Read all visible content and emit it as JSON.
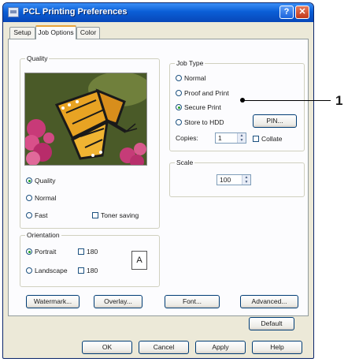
{
  "window": {
    "title": "PCL Printing Preferences"
  },
  "tabs": [
    "Setup",
    "Job Options",
    "Color"
  ],
  "quality": {
    "legend": "Quality",
    "options": [
      "Quality",
      "Normal",
      "Fast"
    ],
    "selected": "Quality",
    "toner_saving": "Toner saving"
  },
  "job_type": {
    "legend": "Job Type",
    "options": [
      "Normal",
      "Proof and Print",
      "Secure Print",
      "Store to HDD"
    ],
    "selected": "Secure Print",
    "pin_button": "PIN...",
    "copies_label": "Copies:",
    "copies_value": "1",
    "collate_label": "Collate"
  },
  "scale": {
    "legend": "Scale",
    "value": "100"
  },
  "orientation": {
    "legend": "Orientation",
    "portrait": "Portrait",
    "landscape": "Landscape",
    "rotate_180_a": "180",
    "rotate_180_b": "180",
    "paper_letter": "A"
  },
  "buttons": {
    "watermark": "Watermark...",
    "overlay": "Overlay...",
    "font": "Font...",
    "advanced": "Advanced...",
    "default": "Default"
  },
  "dialog_buttons": {
    "ok": "OK",
    "cancel": "Cancel",
    "apply": "Apply",
    "help": "Help"
  },
  "callout": {
    "number": "1"
  }
}
